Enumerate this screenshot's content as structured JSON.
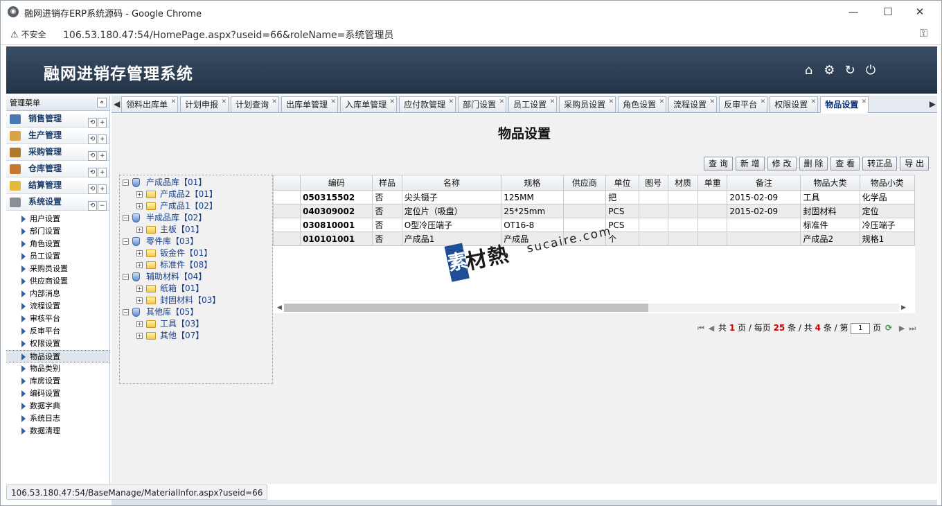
{
  "browser": {
    "window_title": "融网进销存ERP系统源码 - Google Chrome",
    "security_label": "不安全",
    "url": "106.53.180.47:54/HomePage.aspx?useid=66&roleName=系统管理员",
    "status_url": "106.53.180.47:54/BaseManage/MaterialInfor.aspx?useid=66"
  },
  "app": {
    "title": "融网进销存管理系统"
  },
  "sidebar": {
    "header": "管理菜单",
    "groups": [
      {
        "label": "销售管理",
        "color": "#4a78b5"
      },
      {
        "label": "生产管理",
        "color": "#d9a441"
      },
      {
        "label": "采购管理",
        "color": "#b07a2a"
      },
      {
        "label": "仓库管理",
        "color": "#c9772d"
      },
      {
        "label": "结算管理",
        "color": "#e3b93a"
      },
      {
        "label": "系统设置",
        "color": "#8a8f96"
      }
    ],
    "items": [
      "用户设置",
      "部门设置",
      "角色设置",
      "员工设置",
      "采购员设置",
      "供应商设置",
      "内部消息",
      "流程设置",
      "审核平台",
      "反审平台",
      "权限设置",
      "物品设置",
      "物品类别",
      "库房设置",
      "编码设置",
      "数据字典",
      "系统日志",
      "数据清理"
    ]
  },
  "tabs": [
    "领料出库单",
    "计划申报",
    "计划查询",
    "出库单管理",
    "入库单管理",
    "应付款管理",
    "部门设置",
    "员工设置",
    "采购员设置",
    "角色设置",
    "流程设置",
    "反审平台",
    "权限设置",
    "物品设置"
  ],
  "page": {
    "title": "物品设置"
  },
  "toolbar": [
    "查 询",
    "新 增",
    "修 改",
    "删 除",
    "查 看",
    "转正品",
    "导 出"
  ],
  "tree": [
    {
      "level": 0,
      "label": "产成品库【01】",
      "exp": "−"
    },
    {
      "level": 1,
      "label": "产成品2【01】",
      "exp": "+"
    },
    {
      "level": 1,
      "label": "产成品1【02】",
      "exp": "+"
    },
    {
      "level": 0,
      "label": "半成品库【02】",
      "exp": "−"
    },
    {
      "level": 1,
      "label": "主板【01】",
      "exp": "+"
    },
    {
      "level": 0,
      "label": "零件库【03】",
      "exp": "−"
    },
    {
      "level": 1,
      "label": "钣金件【01】",
      "exp": "+"
    },
    {
      "level": 1,
      "label": "标准件【08】",
      "exp": "+"
    },
    {
      "level": 0,
      "label": "辅助材料【04】",
      "exp": "−"
    },
    {
      "level": 1,
      "label": "纸箱【01】",
      "exp": "+"
    },
    {
      "level": 1,
      "label": "封固材料【03】",
      "exp": "+"
    },
    {
      "level": 0,
      "label": "其他库【05】",
      "exp": "−"
    },
    {
      "level": 1,
      "label": "工具【03】",
      "exp": "+"
    },
    {
      "level": 1,
      "label": "其他【07】",
      "exp": "+"
    }
  ],
  "grid": {
    "columns": [
      "编码",
      "样品",
      "名称",
      "规格",
      "供应商",
      "单位",
      "图号",
      "材质",
      "单重",
      "备注",
      "物品大类",
      "物品小类"
    ],
    "rows": [
      [
        "050315502",
        "否",
        "尖头镊子",
        "125MM",
        "",
        "把",
        "",
        "",
        "",
        "2015-02-09",
        "工具",
        "化学品"
      ],
      [
        "040309002",
        "否",
        "定位片（吸盘）",
        "25*25mm",
        "",
        "PCS",
        "",
        "",
        "",
        "2015-02-09",
        "封固材料",
        "定位"
      ],
      [
        "030810001",
        "否",
        "O型冷压端子",
        "OT16-8",
        "",
        "PCS",
        "",
        "",
        "",
        "",
        "标准件",
        "冷压端子"
      ],
      [
        "010101001",
        "否",
        "产成品1",
        "产成品",
        "",
        "个",
        "",
        "",
        "",
        "",
        "产成品2",
        "规格1"
      ]
    ]
  },
  "pager": {
    "prefix": "共",
    "pages": "1",
    "per_label": "页 / 每页",
    "per_page": "25",
    "total_label": "条 / 共",
    "total": "4",
    "current_label": "条 / 第",
    "current": "1",
    "suffix": "页"
  },
  "watermark": {
    "logo_char": "素",
    "text": "材熱",
    "url": "sucaire.com"
  }
}
